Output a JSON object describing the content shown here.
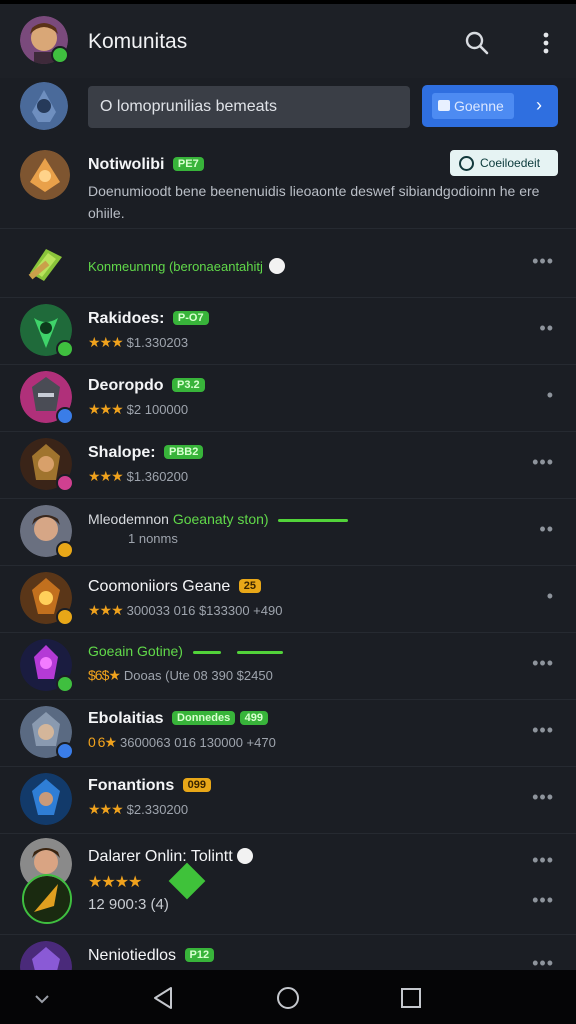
{
  "header": {
    "title": "Komunitas",
    "icons": {
      "search": "search-icon",
      "more": "more-vert-icon"
    },
    "accent": "#2f6fe0"
  },
  "search": {
    "placeholder": "O lomoprunilias bemeats",
    "button_label": "Goenne",
    "button_icon": "chevron-right-icon"
  },
  "notice": {
    "name": "Notiwolibi",
    "badge": "PE7",
    "status": "Coeiloedeit",
    "description": "Doenumioodt bene beenenuidis lieoaonte deswef sibiandgodioinn he ere ohiile."
  },
  "feature": {
    "text": "Konmeunnng (beronaeantahitj",
    "icon": "verified-icon"
  },
  "items": [
    {
      "name": "Rakidoes:",
      "badge": "P-O7",
      "badge_color": "green",
      "stars": "★★★",
      "meta": "$1.330203"
    },
    {
      "name": "Deoropdo",
      "badge": "P3.2",
      "badge_color": "green",
      "stars": "★★★",
      "meta": "$2 100000"
    },
    {
      "name": "Shalope:",
      "badge": "PBB2",
      "badge_color": "green",
      "stars": "★★★",
      "meta": "$1.360200"
    },
    {
      "name": "Mleodemnon",
      "highlight": "Goeanaty ston)",
      "sub": "1 nonms"
    },
    {
      "name": "Coomoniiors Geane",
      "badge": "25",
      "badge_color": "yellow",
      "stars": "★★★",
      "meta": "300033 016  $133300  +490"
    },
    {
      "name": "Goeain Gotine)",
      "green": true,
      "stars": "$6$★",
      "meta": "Dooas (Ute   08 390 $2450"
    },
    {
      "name": "Ebolaitias",
      "badge": "Donnedes",
      "badge2": "499",
      "badge_color": "green",
      "stars": "0 6★",
      "meta": "3600063 016  130000  +470"
    },
    {
      "name": "Fonantions",
      "badge": "099",
      "badge_color": "yellow",
      "stars": "★★★",
      "meta": "$2.330200"
    },
    {
      "name": "Dalarer Onlin: Tolintt",
      "stars": "★★★★",
      "meta": "12 900:3 (4)"
    },
    {
      "name": "Neniotiedlos",
      "badge": "P12",
      "badge_color": "green"
    }
  ],
  "navbar": {
    "icons": [
      "chevron-down-icon",
      "back-triangle-icon",
      "home-circle-icon",
      "recents-square-icon"
    ]
  }
}
